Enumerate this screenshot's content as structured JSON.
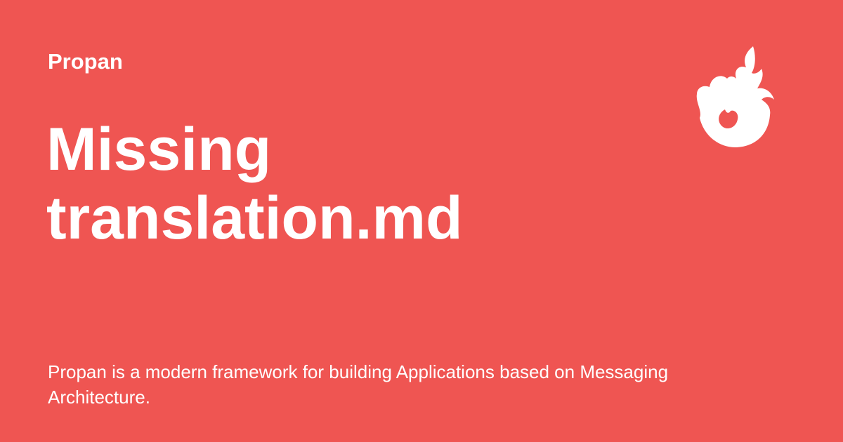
{
  "header": {
    "site_name": "Propan"
  },
  "main": {
    "title": "Missing translation.md",
    "description": "Propan is a modern framework for building Applications based on Messaging Architecture."
  },
  "logo": {
    "icon": "flame-icon",
    "color": "#ffffff"
  },
  "theme": {
    "background": "#ef5552",
    "text": "#ffffff"
  }
}
